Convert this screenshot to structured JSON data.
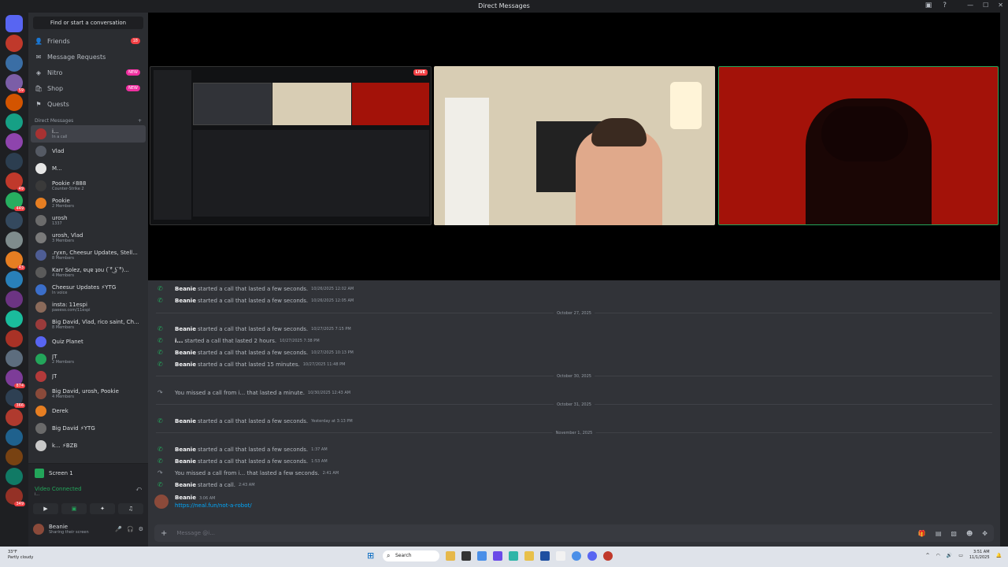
{
  "window": {
    "title": "Direct Messages",
    "controls": [
      "—",
      "☐",
      "✕"
    ]
  },
  "servers": [
    {
      "color": "#5865f2",
      "badge": ""
    },
    {
      "color": "#c0392b",
      "badge": ""
    },
    {
      "color": "#3a6ea5",
      "badge": ""
    },
    {
      "color": "#7b5ea7",
      "badge": "59"
    },
    {
      "color": "#d35400",
      "badge": ""
    },
    {
      "color": "#16a085",
      "badge": ""
    },
    {
      "color": "#8e44ad",
      "badge": ""
    },
    {
      "color": "#2c3e50",
      "badge": ""
    },
    {
      "color": "#c0392b",
      "badge": "49"
    },
    {
      "color": "#27ae60",
      "badge": "449"
    },
    {
      "color": "#34495e",
      "badge": ""
    },
    {
      "color": "#7f8c8d",
      "badge": ""
    },
    {
      "color": "#e67e22",
      "badge": "43"
    },
    {
      "color": "#2980b9",
      "badge": ""
    },
    {
      "color": "#6c3483",
      "badge": ""
    },
    {
      "color": "#1abc9c",
      "badge": ""
    },
    {
      "color": "#a93226",
      "badge": ""
    },
    {
      "color": "#5d6d7e",
      "badge": ""
    },
    {
      "color": "#7d3c98",
      "badge": "874"
    },
    {
      "color": "#2e4053",
      "badge": "366"
    },
    {
      "color": "#b03a2e",
      "badge": ""
    },
    {
      "color": "#1f618d",
      "badge": ""
    },
    {
      "color": "#784212",
      "badge": ""
    },
    {
      "color": "#117a65",
      "badge": ""
    },
    {
      "color": "#943126",
      "badge": "349"
    }
  ],
  "sidebar": {
    "find": "Find or start a conversation",
    "nav": [
      {
        "label": "Friends",
        "icon": "👤",
        "pill": "18",
        "new": ""
      },
      {
        "label": "Message Requests",
        "icon": "✉",
        "pill": "",
        "new": ""
      },
      {
        "label": "Nitro",
        "icon": "◈",
        "pill": "",
        "new": "NEW"
      },
      {
        "label": "Shop",
        "icon": "🛍",
        "pill": "",
        "new": "NEW"
      },
      {
        "label": "Quests",
        "icon": "⚑",
        "pill": "",
        "new": ""
      }
    ],
    "dm_header": "Direct Messages",
    "dms": [
      {
        "name": "i...",
        "sub": "In a call",
        "color": "#a83232"
      },
      {
        "name": "Vlad",
        "sub": "",
        "color": "#555a64"
      },
      {
        "name": "M...",
        "sub": "",
        "color": "#e6e6e6"
      },
      {
        "name": "Pookie ⚡888",
        "sub": "Counter-Strike 2",
        "color": "#3a3a3a"
      },
      {
        "name": "Pookie",
        "sub": "2 Members",
        "color": "#e67e22"
      },
      {
        "name": "urosh",
        "sub": "1337",
        "color": "#6b6b6b"
      },
      {
        "name": "urosh, Vlad",
        "sub": "3 Members",
        "color": "#7a7a7a"
      },
      {
        "name": ".ryxn, Cheesur Updates, Stell...",
        "sub": "8 Members",
        "color": "#4e5d94"
      },
      {
        "name": "Karr Solez, ɐɥɐ ʇou ( ͡° ͜ʖ ͡°)...",
        "sub": "4 Members",
        "color": "#5a5a5a"
      },
      {
        "name": "Cheesur Updates ⚡YTG",
        "sub": "In voice",
        "color": "#3b6ec9"
      },
      {
        "name": "insta: 11espi",
        "sub": "paeeso.com/11espi",
        "color": "#8a6a5a"
      },
      {
        "name": "Big David, Vlad, rico saint, Ch...",
        "sub": "8 Members",
        "color": "#9a3b3b"
      },
      {
        "name": "Quiz Planet",
        "sub": "",
        "color": "#5865f2"
      },
      {
        "name": "JT",
        "sub": "2 Members",
        "color": "#23a55a"
      },
      {
        "name": "JT",
        "sub": "",
        "color": "#b33a3a"
      },
      {
        "name": "Big David, urosh, Pookie",
        "sub": "4 Members",
        "color": "#8a4a3a"
      },
      {
        "name": "Derek",
        "sub": "",
        "color": "#e67e22"
      },
      {
        "name": "Big David ⚡YTG",
        "sub": "",
        "color": "#6a6a6a"
      },
      {
        "name": "k... ⚡BZB",
        "sub": "",
        "color": "#c9c9c9"
      }
    ]
  },
  "voice": {
    "screen_label": "Screen 1",
    "connected": "Video Connected",
    "connected_sub": "i...",
    "user_name": "Beanie",
    "user_status": "Sharing their screen"
  },
  "stage": {
    "live_badge": "LIVE"
  },
  "chat": {
    "messages": [
      {
        "kind": "ok",
        "who": "Beanie",
        "text": "started a call that lasted a few seconds.",
        "ts": "10/26/2025 12:02 AM"
      },
      {
        "kind": "ok",
        "who": "Beanie",
        "text": "started a call that lasted a few seconds.",
        "ts": "10/26/2025 12:05 AM"
      },
      {
        "kind": "ok",
        "who": "Beanie",
        "text": "started a call that lasted a few seconds.",
        "ts": "10/27/2025 7:15 PM"
      },
      {
        "kind": "ok",
        "who": "i...",
        "text": "started a call that lasted 2 hours.",
        "ts": "10/27/2025 7:38 PM"
      },
      {
        "kind": "ok",
        "who": "Beanie",
        "text": "started a call that lasted a few seconds.",
        "ts": "10/27/2025 10:13 PM"
      },
      {
        "kind": "ok",
        "who": "Beanie",
        "text": "started a call that lasted 15 minutes.",
        "ts": "10/27/2025 11:48 PM"
      },
      {
        "kind": "miss",
        "who": "",
        "text": "You missed a call from i... that lasted a minute.",
        "ts": "10/30/2025 12:43 AM"
      },
      {
        "kind": "ok",
        "who": "Beanie",
        "text": "started a call that lasted a few seconds.",
        "ts": "Yesterday at 3:13 PM"
      },
      {
        "kind": "ok",
        "who": "Beanie",
        "text": "started a call that lasted a few seconds.",
        "ts": "1:37 AM"
      },
      {
        "kind": "ok",
        "who": "Beanie",
        "text": "started a call that lasted a few seconds.",
        "ts": "1:53 AM"
      },
      {
        "kind": "miss",
        "who": "",
        "text": "You missed a call from i... that lasted a few seconds.",
        "ts": "2:41 AM"
      },
      {
        "kind": "ok",
        "who": "Beanie",
        "text": "started a call.",
        "ts": "2:43 AM"
      }
    ],
    "dividers": [
      "October 27, 2025",
      "October 30, 2025",
      "October 31, 2025",
      "November 1, 2025"
    ],
    "last": {
      "name": "Beanie",
      "ts": "3:06 AM",
      "link": "https://neal.fun/not-a-robot/"
    },
    "composer_placeholder": "Message @i..."
  },
  "taskbar": {
    "temp": "33°F",
    "weather": "Partly cloudy",
    "search": "Search",
    "time": "3:51 AM",
    "date": "11/1/2025"
  }
}
